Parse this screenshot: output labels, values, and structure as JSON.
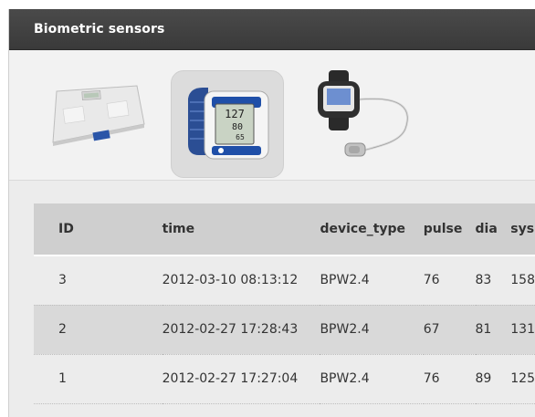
{
  "window": {
    "title": "Biometric sensors"
  },
  "devices": [
    {
      "icon": "body-scale-icon"
    },
    {
      "icon": "wrist-blood-pressure-monitor-icon",
      "selected": true,
      "display": [
        "127",
        "80",
        "65"
      ]
    },
    {
      "icon": "pulse-oximeter-watch-icon"
    }
  ],
  "table": {
    "headers": {
      "id": "ID",
      "time": "time",
      "device_type": "device_type",
      "pulse": "pulse",
      "dia": "dia",
      "sys": "sys"
    },
    "rows": [
      {
        "id": "3",
        "time": "2012-03-10 08:13:12",
        "device_type": "BPW2.4",
        "pulse": "76",
        "dia": "83",
        "sys": "158"
      },
      {
        "id": "2",
        "time": "2012-02-27 17:28:43",
        "device_type": "BPW2.4",
        "pulse": "67",
        "dia": "81",
        "sys": "131"
      },
      {
        "id": "1",
        "time": "2012-02-27 17:27:04",
        "device_type": "BPW2.4",
        "pulse": "76",
        "dia": "89",
        "sys": "125"
      }
    ]
  },
  "colors": {
    "titlebar": "#3f3f3f",
    "header_row": "#cfcfcf",
    "alt_row": "#d9d9d9",
    "monitor_blue": "#1f4fa8"
  }
}
